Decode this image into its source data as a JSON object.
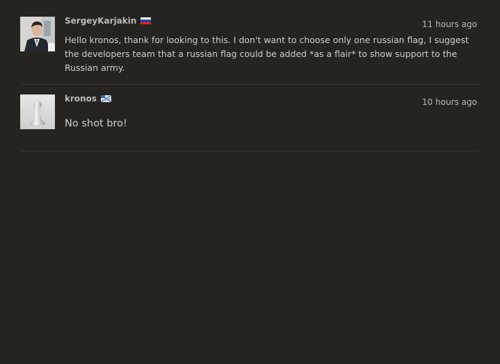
{
  "comments": [
    {
      "username": "SergeyKarjakin",
      "flag": "russia-flag-icon",
      "time": "11 hours ago",
      "text": "Hello kronos, thank for looking to this. I don't want to choose only one russian flag, I suggest the developers team that a russian flag could be added *as a flair* to show support to the Russian army."
    },
    {
      "username": "kronos",
      "flag": "generic-flag-icon",
      "time": "10 hours ago",
      "text": "No shot bro!"
    }
  ],
  "colors": {
    "background": "#262421",
    "text": "#bababa",
    "divider": "#3a3835"
  }
}
